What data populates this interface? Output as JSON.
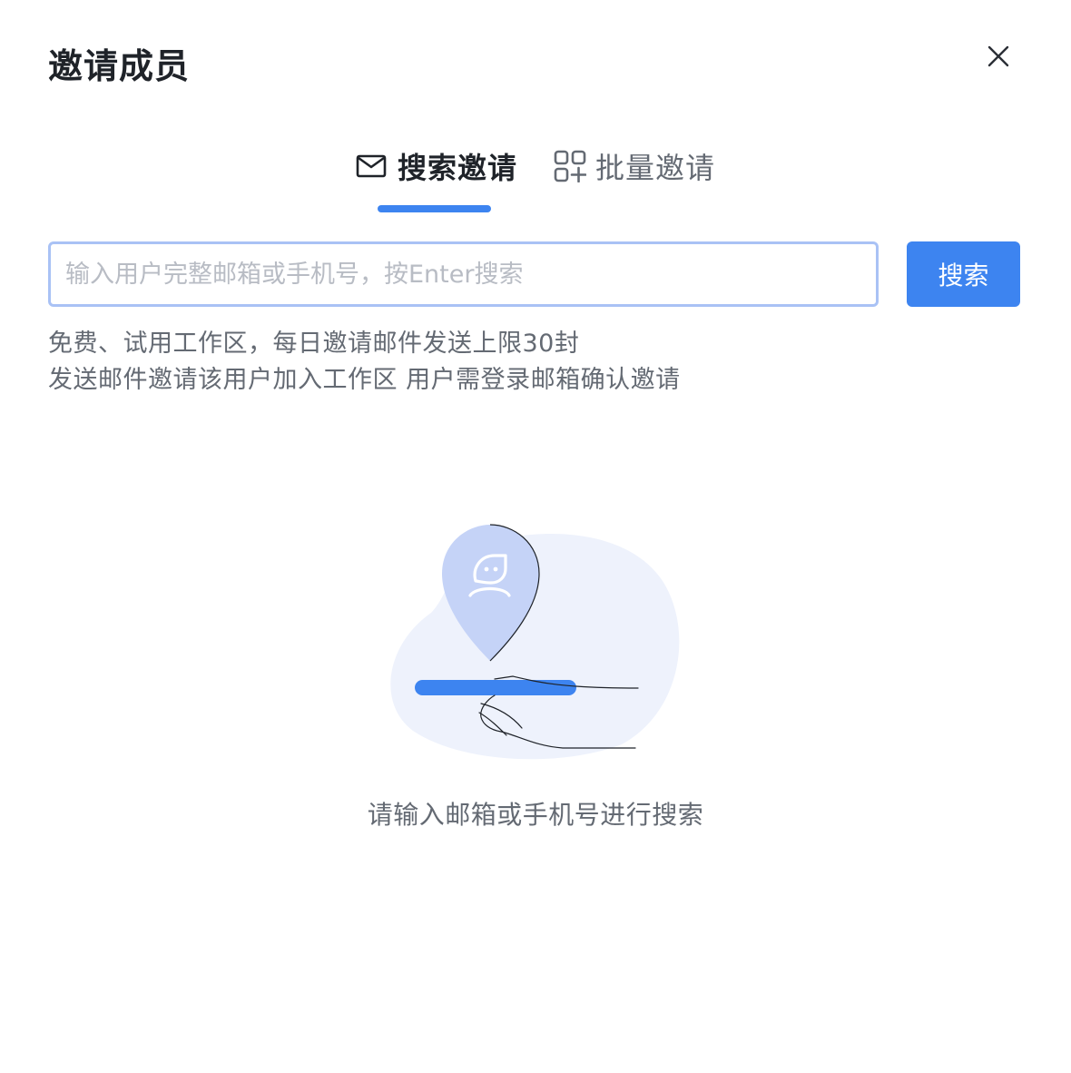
{
  "dialog": {
    "title": "邀请成员"
  },
  "tabs": [
    {
      "label": "搜索邀请",
      "icon": "mail-icon",
      "active": true
    },
    {
      "label": "批量邀请",
      "icon": "batch-grid-icon",
      "active": false
    }
  ],
  "search": {
    "placeholder": "输入用户完整邮箱或手机号，按Enter搜索",
    "value": "",
    "button_label": "搜索"
  },
  "hints": {
    "line1": "免费、试用工作区，每日邀请邮件发送上限30封",
    "line2": "发送邮件邀请该用户加入工作区 用户需登录邮箱确认邀请"
  },
  "empty_state": {
    "illustration": "hand-holding-location-pin-illustration",
    "text": "请输入邮箱或手机号进行搜索"
  },
  "colors": {
    "accent": "#3d84f0",
    "input_border": "#a9c2f5",
    "text_primary": "#1f2329",
    "text_secondary": "#646a73",
    "placeholder": "#b8bcc4",
    "pin_fill": "#c5d3f7",
    "blob_fill": "#eef2fc"
  }
}
